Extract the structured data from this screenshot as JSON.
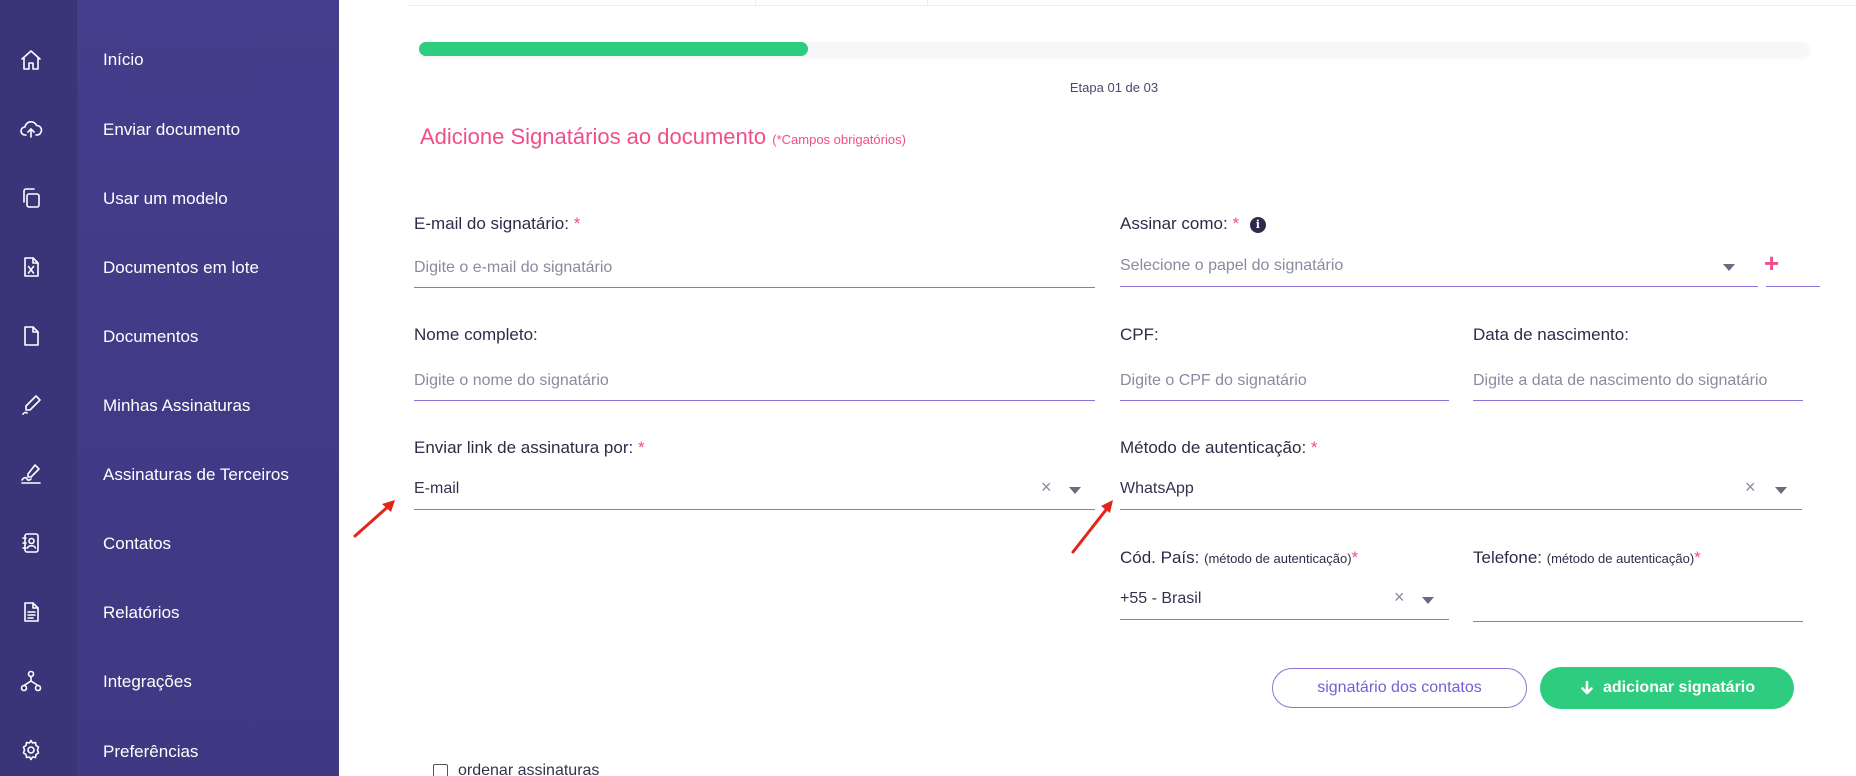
{
  "sidebar": {
    "items": [
      {
        "label": "Início",
        "icon": "home-icon"
      },
      {
        "label": "Enviar documento",
        "icon": "cloud-upload-icon"
      },
      {
        "label": "Usar um modelo",
        "icon": "template-icon"
      },
      {
        "label": "Documentos em lote",
        "icon": "excel-file-icon"
      },
      {
        "label": "Documentos",
        "icon": "document-icon"
      },
      {
        "label": "Minhas Assinaturas",
        "icon": "pen-icon"
      },
      {
        "label": "Assinaturas de Terceiros",
        "icon": "signature-icon"
      },
      {
        "label": "Contatos",
        "icon": "contact-book-icon"
      },
      {
        "label": "Relatórios",
        "icon": "report-icon"
      },
      {
        "label": "Integrações",
        "icon": "integration-icon"
      },
      {
        "label": "Preferências",
        "icon": "gear-icon"
      }
    ]
  },
  "progress": {
    "fraction": 0.28,
    "step_text": "Etapa 01 de 03"
  },
  "form": {
    "title": "Adicione Signatários ao documento",
    "required_note": "(*Campos obrigatórios)",
    "email": {
      "label": "E-mail do signatário:",
      "placeholder": "Digite o e-mail do signatário"
    },
    "sign_as": {
      "label": "Assinar como:",
      "placeholder": "Selecione o papel do signatário"
    },
    "full_name": {
      "label": "Nome completo:",
      "placeholder": "Digite o nome do signatário"
    },
    "cpf": {
      "label": "CPF:",
      "placeholder": "Digite o CPF do signatário"
    },
    "birth_date": {
      "label": "Data de nascimento:",
      "placeholder": "Digite a data de nascimento do signatário"
    },
    "send_link": {
      "label": "Enviar link de assinatura por:",
      "value": "E-mail"
    },
    "auth_method": {
      "label": "Método de autenticação:",
      "value": "WhatsApp"
    },
    "country_code": {
      "label": "Cód. País:",
      "note": "(método de autenticação)",
      "value": "+55 - Brasil"
    },
    "phone": {
      "label": "Telefone:",
      "note": "(método de autenticação)",
      "value": ""
    },
    "required_mark": "*",
    "clear_symbol": "×",
    "info_symbol": "i",
    "plus_symbol": "+"
  },
  "buttons": {
    "from_contacts": "signatário dos contatos",
    "add_signer": "adicionar signatário"
  },
  "options": {
    "order_signatures": "ordenar assinaturas"
  },
  "colors": {
    "sidebar_dark": "#3a3478",
    "sidebar": "#433d8b",
    "accent_pink": "#ee4f8a",
    "accent_purple": "#8f6fd8",
    "progress_green": "#2ecc7f",
    "annotation_arrow": "#e3241b"
  }
}
